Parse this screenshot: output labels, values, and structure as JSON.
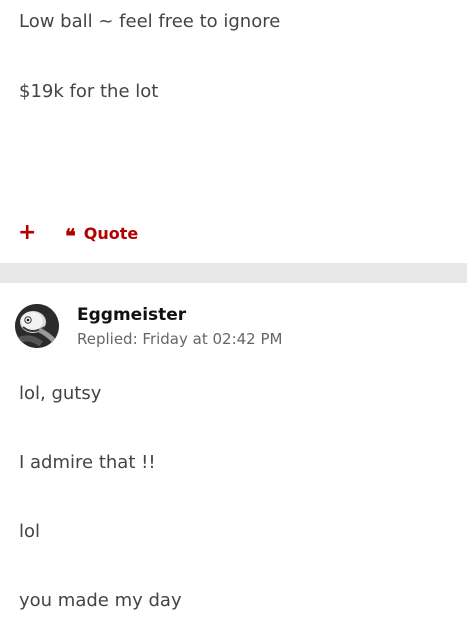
{
  "first_post": {
    "lines": [
      "Low ball ~ feel free to ignore",
      "$19k for the lot"
    ],
    "actions": {
      "plus_label": "+",
      "quote_icon": "❝",
      "quote_label": "Quote"
    }
  },
  "second_post": {
    "author": {
      "name": "Eggmeister",
      "avatar_icon": "avatar-icon"
    },
    "replied_label": "Replied: Friday at 02:42 PM",
    "lines": [
      "lol, gutsy",
      "I admire that !!",
      "lol",
      "you made my day"
    ]
  },
  "colors": {
    "accent": "#b30000",
    "separator": "#e8e8e8",
    "body_text": "#444444"
  }
}
